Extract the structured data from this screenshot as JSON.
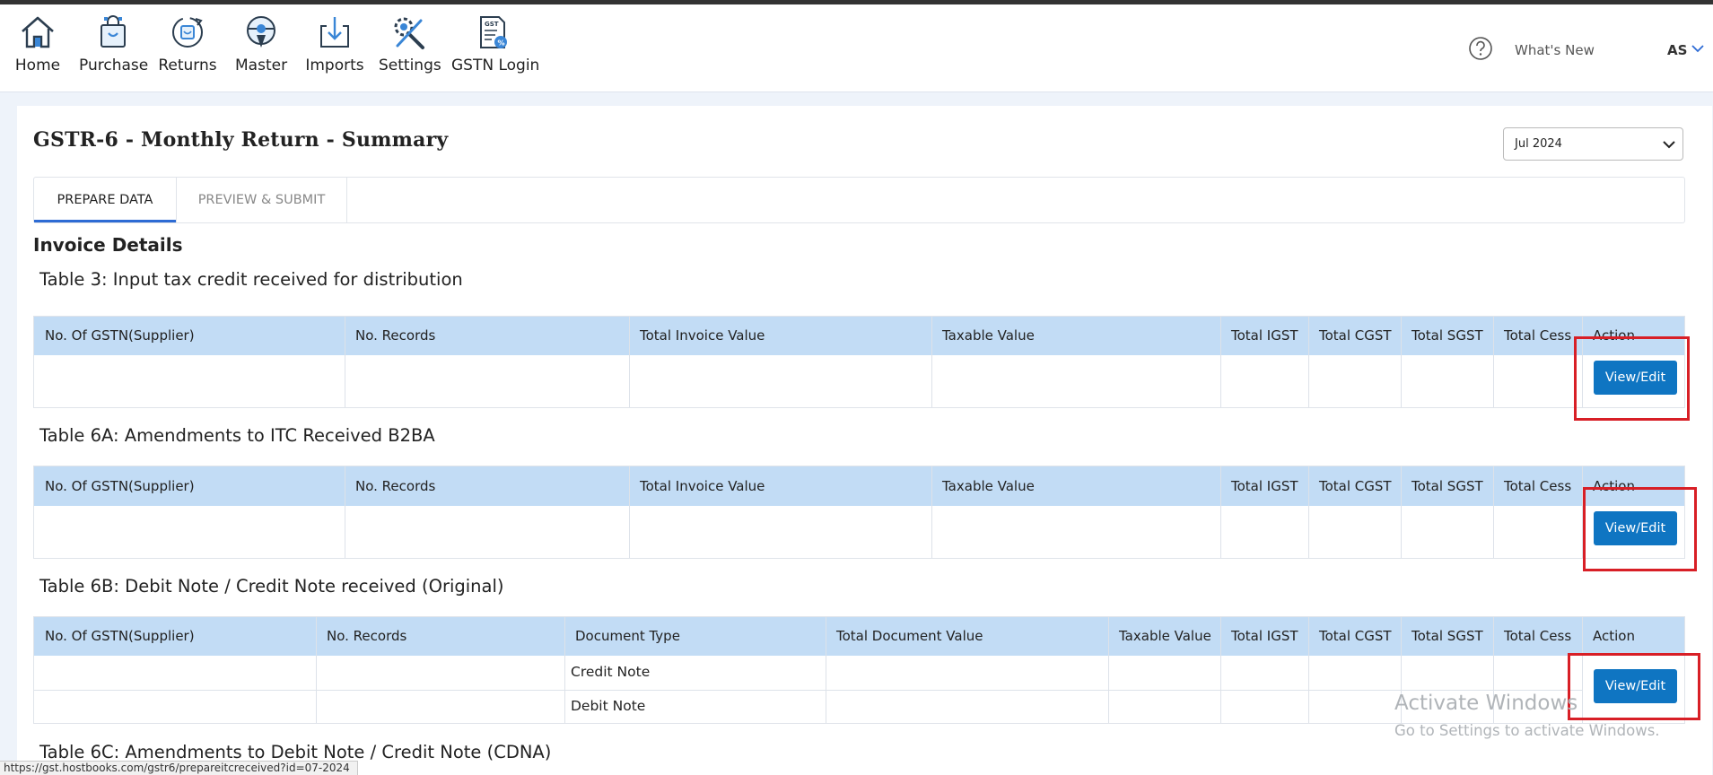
{
  "nav": [
    {
      "label": "Home",
      "icon": "home-icon"
    },
    {
      "label": "Purchase",
      "icon": "shopping-bag-icon"
    },
    {
      "label": "Returns",
      "icon": "returns-icon"
    },
    {
      "label": "Master",
      "icon": "master-icon"
    },
    {
      "label": "Imports",
      "icon": "download-tray-icon"
    },
    {
      "label": "Settings",
      "icon": "tools-icon"
    },
    {
      "label": "GSTN Login",
      "icon": "gst-document-icon"
    }
  ],
  "header": {
    "whats_new": "What's New",
    "user_initials": "AS"
  },
  "page": {
    "title": "GSTR-6 - Monthly Return - Summary",
    "month": "Jul 2024"
  },
  "tabs": [
    "PREPARE DATA",
    "PREVIEW & SUBMIT"
  ],
  "section_heading": "Invoice Details",
  "table3": {
    "title": "Table 3: Input tax credit received for distribution",
    "headers": [
      "No. Of GSTN(Supplier)",
      "No. Records",
      "Total Invoice Value",
      "Taxable Value",
      "Total IGST",
      "Total CGST",
      "Total SGST",
      "Total Cess",
      "Action"
    ],
    "button": "View/Edit"
  },
  "table6a": {
    "title": "Table 6A: Amendments to ITC Received B2BA",
    "headers": [
      "No. Of GSTN(Supplier)",
      "No. Records",
      "Total Invoice Value",
      "Taxable Value",
      "Total IGST",
      "Total CGST",
      "Total SGST",
      "Total Cess",
      "Action"
    ],
    "button": "View/Edit"
  },
  "table6b": {
    "title": "Table 6B: Debit Note / Credit Note received (Original)",
    "headers": [
      "No. Of GSTN(Supplier)",
      "No. Records",
      "Document Type",
      "Total Document Value",
      "Taxable Value",
      "Total IGST",
      "Total CGST",
      "Total SGST",
      "Total Cess",
      "Action"
    ],
    "rows": [
      {
        "document_type": "Credit Note"
      },
      {
        "document_type": "Debit Note"
      }
    ],
    "button": "View/Edit"
  },
  "table6c": {
    "title": "Table 6C: Amendments to Debit Note / Credit Note (CDNA)"
  },
  "watermark": {
    "title": "Activate Windows",
    "subtitle": "Go to Settings to activate Windows."
  },
  "status_url": "https://gst.hostbooks.com/gstr6/prepareitcreceived?id=07-2024",
  "colors": {
    "accent_button": "#0f75c2",
    "table_header": "#c2dcf5",
    "highlight": "#d81f26",
    "tab_underline": "#2d6bd4"
  }
}
